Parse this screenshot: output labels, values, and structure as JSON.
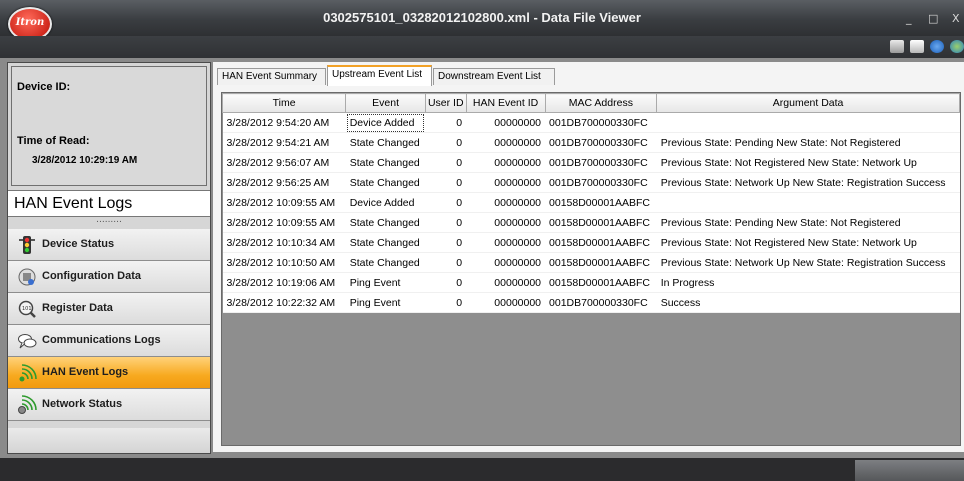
{
  "window": {
    "title": "0302575101_03282012102800.xml - Data File Viewer",
    "logo_text": "Itron",
    "controls": [
      "_",
      "□",
      "X"
    ]
  },
  "toolbar": {
    "icons": [
      "export-icon",
      "print-icon",
      "help-icon",
      "web-icon"
    ]
  },
  "device_info": {
    "device_id_label": "Device ID:",
    "device_id_value": "",
    "time_of_read_label": "Time of Read:",
    "time_of_read_value": "3/28/2012 10:29:19 AM"
  },
  "sidebar": {
    "section_title": "HAN Event Logs",
    "items": [
      {
        "label": "Device Status",
        "icon": "traffic-light-icon",
        "active": false
      },
      {
        "label": "Configuration Data",
        "icon": "config-icon",
        "active": false
      },
      {
        "label": "Register Data",
        "icon": "magnifier-icon",
        "active": false
      },
      {
        "label": "Communications Logs",
        "icon": "speech-bubbles-icon",
        "active": false
      },
      {
        "label": "HAN Event Logs",
        "icon": "han-signal-icon",
        "active": true
      },
      {
        "label": "Network Status",
        "icon": "network-signal-icon",
        "active": false
      }
    ]
  },
  "tabs": [
    {
      "label": "HAN Event Summary",
      "active": false
    },
    {
      "label": "Upstream Event List",
      "active": true
    },
    {
      "label": "Downstream Event List",
      "active": false
    }
  ],
  "table": {
    "columns": [
      "Time",
      "Event",
      "User ID",
      "HAN Event ID",
      "MAC Address",
      "Argument Data"
    ],
    "rows": [
      [
        "3/28/2012 9:54:20 AM",
        "Device Added",
        "0",
        "00000000",
        "001DB700000330FC",
        ""
      ],
      [
        "3/28/2012 9:54:21 AM",
        "State Changed",
        "0",
        "00000000",
        "001DB700000330FC",
        "Previous State: Pending New State: Not Registered"
      ],
      [
        "3/28/2012 9:56:07 AM",
        "State Changed",
        "0",
        "00000000",
        "001DB700000330FC",
        "Previous State: Not Registered New State: Network Up"
      ],
      [
        "3/28/2012 9:56:25 AM",
        "State Changed",
        "0",
        "00000000",
        "001DB700000330FC",
        "Previous State: Network Up New State: Registration Success"
      ],
      [
        "3/28/2012 10:09:55 AM",
        "Device Added",
        "0",
        "00000000",
        "00158D00001AABFC",
        ""
      ],
      [
        "3/28/2012 10:09:55 AM",
        "State Changed",
        "0",
        "00000000",
        "00158D00001AABFC",
        "Previous State: Pending New State: Not Registered"
      ],
      [
        "3/28/2012 10:10:34 AM",
        "State Changed",
        "0",
        "00000000",
        "00158D00001AABFC",
        "Previous State: Not Registered New State: Network Up"
      ],
      [
        "3/28/2012 10:10:50 AM",
        "State Changed",
        "0",
        "00000000",
        "00158D00001AABFC",
        "Previous State: Network Up New State: Registration Success"
      ],
      [
        "3/28/2012 10:19:06 AM",
        "Ping Event",
        "0",
        "00000000",
        "00158D00001AABFC",
        "In Progress"
      ],
      [
        "3/28/2012 10:22:32 AM",
        "Ping Event",
        "0",
        "00000000",
        "001DB700000330FC",
        "Success"
      ]
    ]
  },
  "colors": {
    "active_nav": "#f7a91f",
    "titlebar": "#3a3d41",
    "logo_red": "#d22b1f"
  }
}
